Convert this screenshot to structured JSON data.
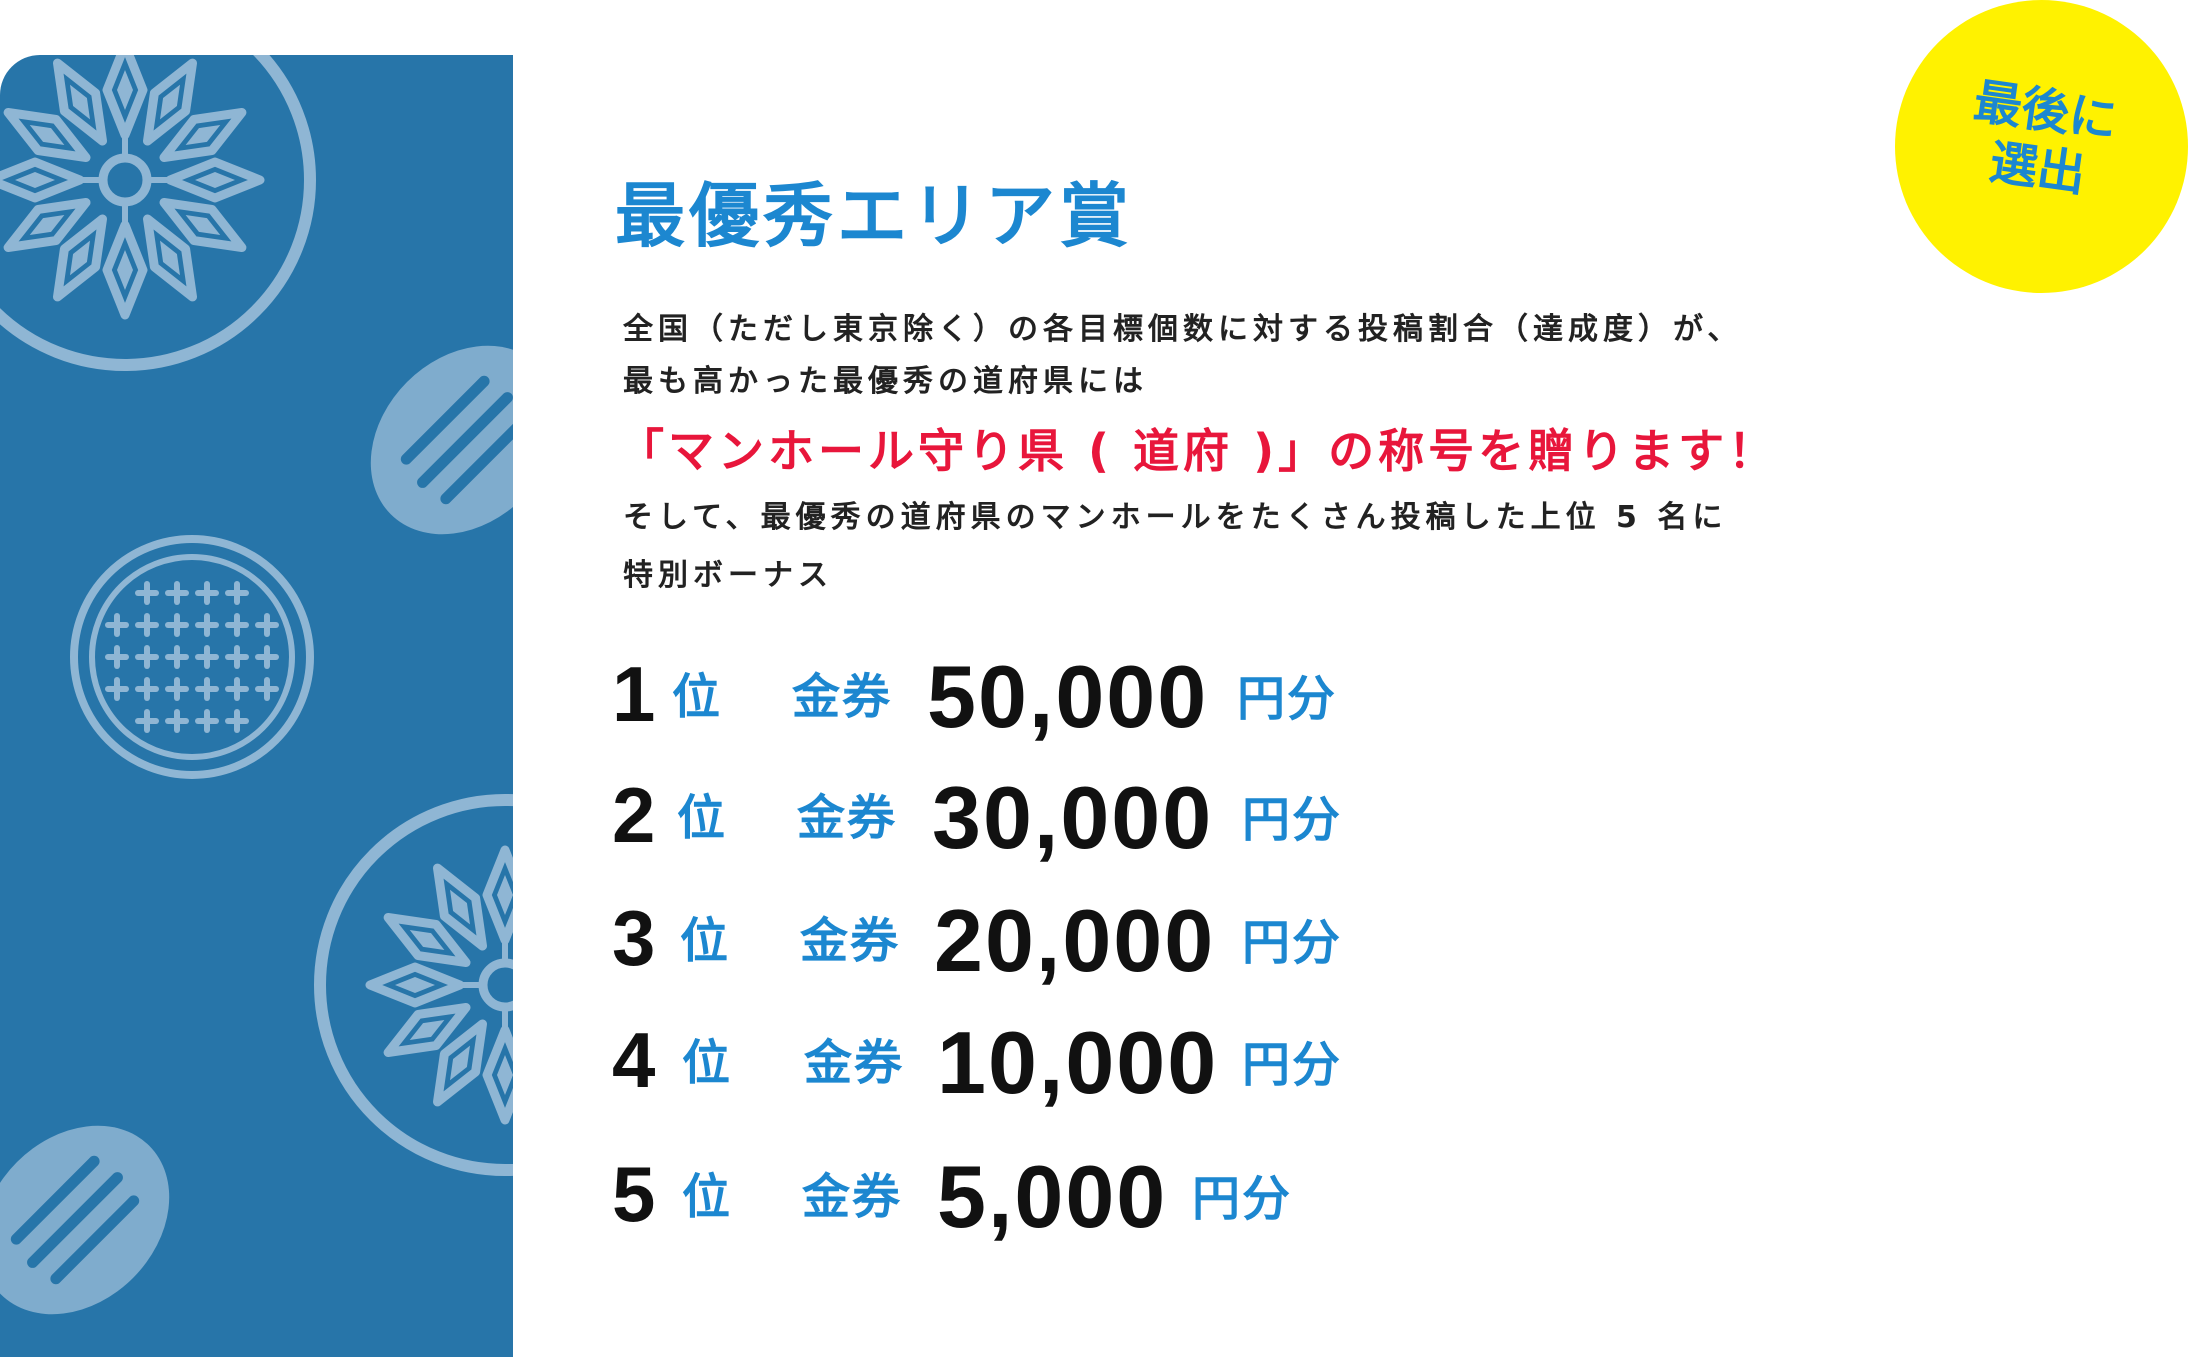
{
  "colors": {
    "panel_blue": "#2775a9",
    "accent_blue": "#1c87d0",
    "badge_yellow": "#fff200",
    "highlight_red": "#e8163b",
    "text_dark": "#222222"
  },
  "badge": {
    "line1": "最後に",
    "line2": "選出"
  },
  "title": "最優秀エリア賞",
  "description": {
    "line1": "全国（ただし東京除く）の各目標個数に対する投稿割合（達成度）が、",
    "line2": "最も高かった最優秀の道府県には",
    "highlight": "「マンホール守り県 ( 道府 )」の称号を贈ります！",
    "line3": "そして、最優秀の道府県のマンホールをたくさん投稿した上位 5 名に",
    "line4": "特別ボーナス"
  },
  "prizes": [
    {
      "rank": "1",
      "rank_suffix": "位",
      "voucher": "金券",
      "amount": "50,000",
      "unit": "円分"
    },
    {
      "rank": "2",
      "rank_suffix": "位",
      "voucher": "金券",
      "amount": "30,000",
      "unit": "円分"
    },
    {
      "rank": "3",
      "rank_suffix": "位",
      "voucher": "金券",
      "amount": "20,000",
      "unit": "円分"
    },
    {
      "rank": "4",
      "rank_suffix": "位",
      "voucher": "金券",
      "amount": "10,000",
      "unit": "円分"
    },
    {
      "rank": "5",
      "rank_suffix": "位",
      "voucher": "金券",
      "amount": "5,000",
      "unit": "円分"
    }
  ],
  "decorations": [
    "manhole-flower-icon",
    "manhole-flower-icon",
    "manhole-grid-icon",
    "drain-slot-icon",
    "drain-slot-icon"
  ]
}
